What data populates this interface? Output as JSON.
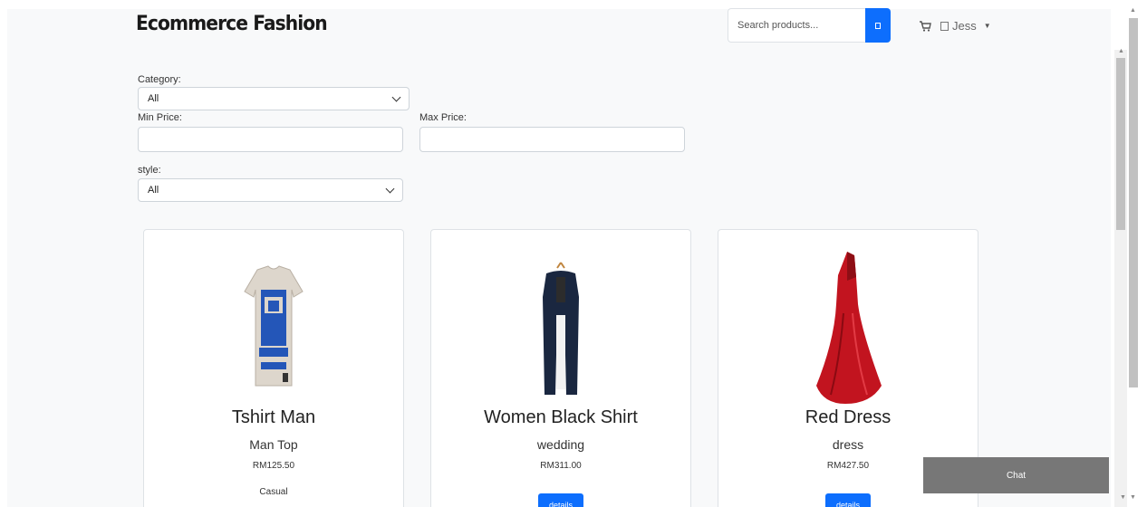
{
  "header": {
    "brand": "Ecommerce Fashion",
    "search_placeholder": "Search products...",
    "user_name": "Jess"
  },
  "filters": {
    "category_label": "Category:",
    "category_value": "All",
    "min_price_label": "Min Price:",
    "min_price_value": "",
    "max_price_label": "Max Price:",
    "max_price_value": "",
    "style_label": "style:",
    "style_value": "All"
  },
  "products": [
    {
      "title": "Tshirt Man",
      "category": "Man Top",
      "price": "RM125.50",
      "style": "Casual",
      "image": "tshirt-image"
    },
    {
      "title": "Women Black Shirt",
      "category": "wedding",
      "price": "RM311.00",
      "details_label": "details",
      "image": "black-shirt-image"
    },
    {
      "title": "Red Dress",
      "category": "dress",
      "price": "RM427.50",
      "details_label": "details",
      "image": "red-dress-image"
    }
  ],
  "chat": {
    "label": "Chat"
  },
  "colors": {
    "primary": "#0d6efd",
    "chat_bg": "#777777",
    "page_bg": "#f8f9fa"
  }
}
